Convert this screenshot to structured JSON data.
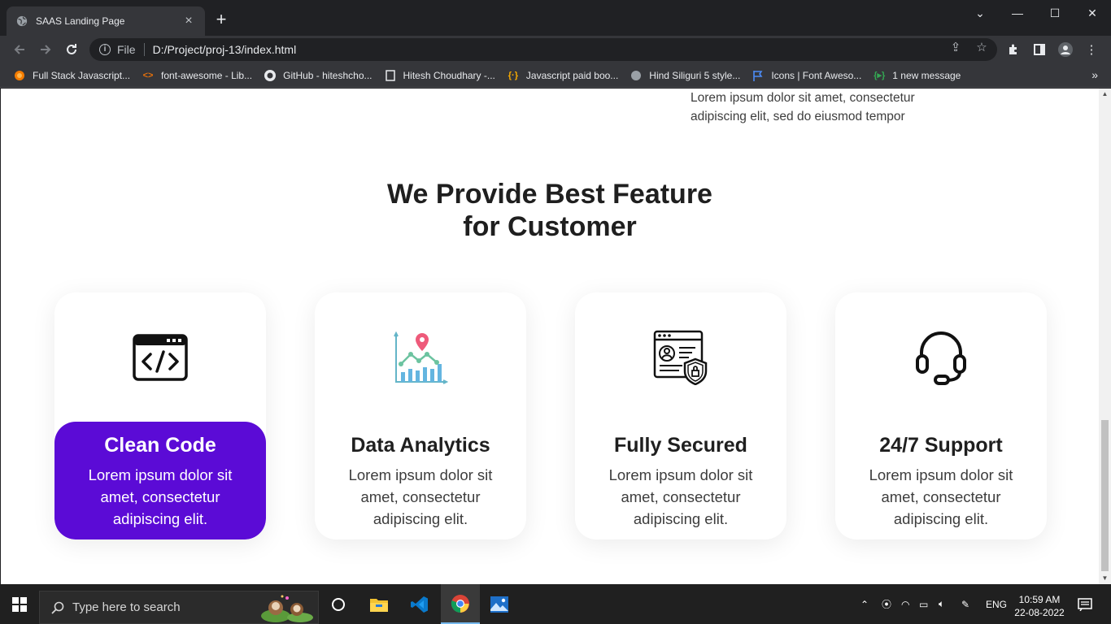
{
  "browser": {
    "tab_title": "SAAS Landing Page",
    "new_tab": "+",
    "url_scheme": "File",
    "url": "D:/Project/proj-13/index.html",
    "window_controls": {
      "minimize": "—",
      "maximize": "☐",
      "close": "✕",
      "dropdown": "⌄"
    }
  },
  "bookmarks": [
    {
      "label": "Full Stack Javascript...",
      "icon": "orange-circle-icon"
    },
    {
      "label": "font-awesome - Lib...",
      "icon": "code-brackets-icon"
    },
    {
      "label": "GitHub - hiteshcho...",
      "icon": "github-icon"
    },
    {
      "label": "Hitesh Choudhary -...",
      "icon": "page-icon"
    },
    {
      "label": "Javascript paid boo...",
      "icon": "braces-icon"
    },
    {
      "label": "Hind Siliguri 5 style...",
      "icon": "globe-icon"
    },
    {
      "label": "Icons | Font Aweso...",
      "icon": "flag-icon"
    },
    {
      "label": "1 new message",
      "icon": "message-icon"
    }
  ],
  "page": {
    "top_paragraph": "Lorem ipsum dolor sit amet, consectetur adipiscing elit, sed do eiusmod tempor",
    "section_title_line1": "We Provide Best Feature",
    "section_title_line2": "for Customer",
    "cards": [
      {
        "title": "Clean Code",
        "text": "Lorem ipsum dolor sit amet, consectetur adipiscing elit.",
        "icon": "code-window-icon",
        "active": true
      },
      {
        "title": "Data Analytics",
        "text": "Lorem ipsum dolor sit amet, consectetur adipiscing elit.",
        "icon": "analytics-chart-icon",
        "active": false
      },
      {
        "title": "Fully Secured",
        "text": "Lorem ipsum dolor sit amet, consectetur adipiscing elit.",
        "icon": "secure-profile-icon",
        "active": false
      },
      {
        "title": "24/7 Support",
        "text": "Lorem ipsum dolor sit amet, consectetur adipiscing elit.",
        "icon": "headset-icon",
        "active": false
      }
    ],
    "accent_color": "#5b0bd6"
  },
  "taskbar": {
    "search_placeholder": "Type here to search",
    "language": "ENG",
    "time": "10:59 AM",
    "date": "22-08-2022"
  }
}
